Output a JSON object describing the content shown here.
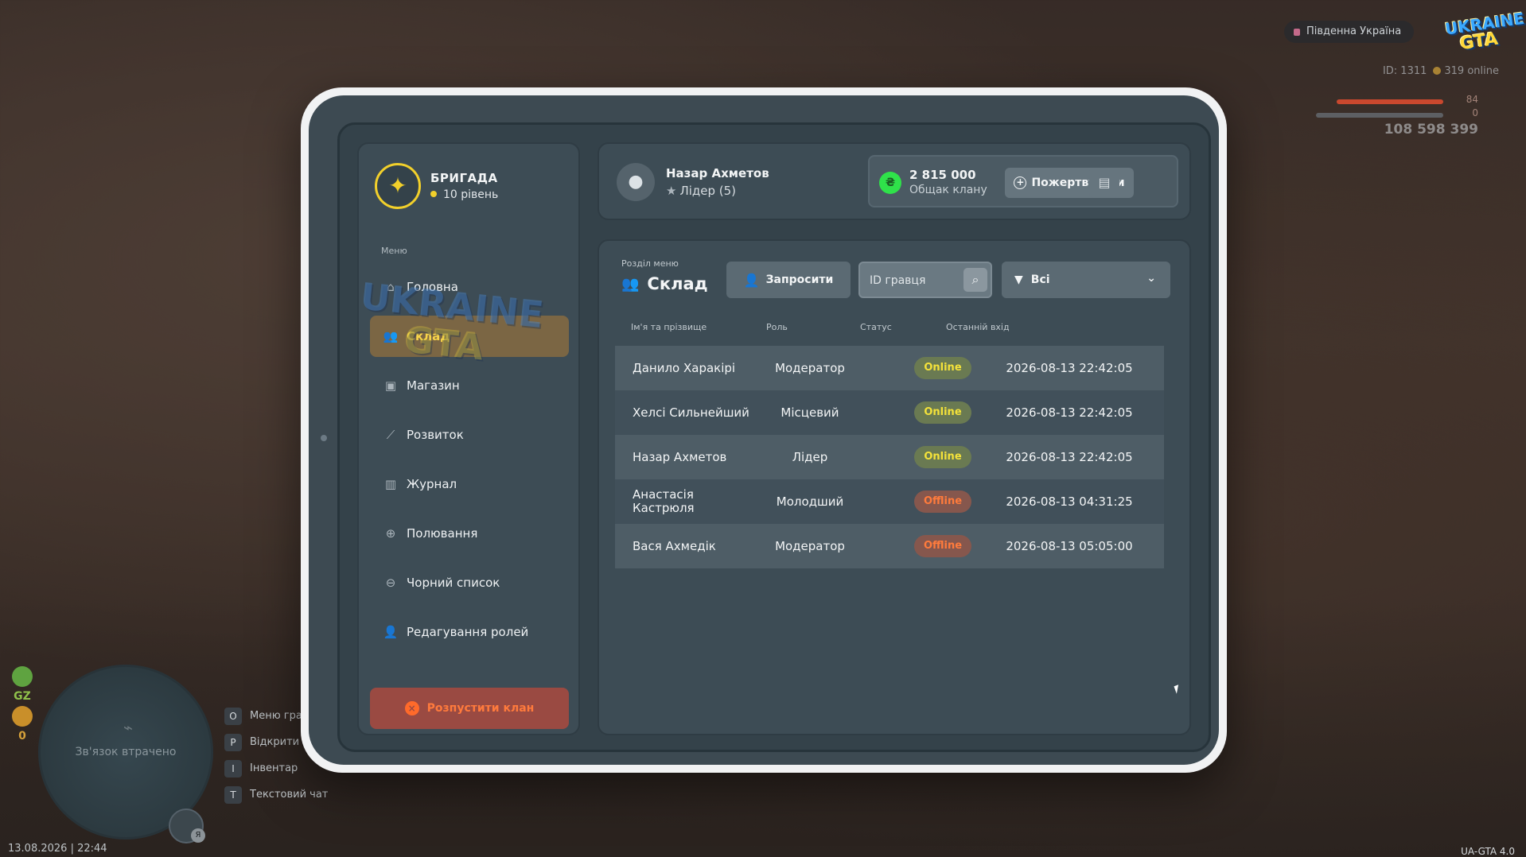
{
  "hud": {
    "region": "Південна Україна",
    "logo_top": "UKRAINE",
    "logo_bottom": "GTA",
    "player_id": "ID: 1311",
    "online": "319 online",
    "health": "84",
    "health_fraction": 0.84,
    "armor": "0",
    "armor_fraction": 0.0,
    "money": "108 598 399",
    "zone": "GZ",
    "wanted": "0",
    "connection": "Зв'язок втрачено",
    "mic_badge": "Я",
    "keys": [
      {
        "key": "O",
        "label": "Меню гравця"
      },
      {
        "key": "P",
        "label": "Відкрити телефон"
      },
      {
        "key": "I",
        "label": "Інвентар"
      },
      {
        "key": "T",
        "label": "Текстовий чат"
      }
    ],
    "datetime": "13.08.2026 | 22:44",
    "version": "UA-GTA 4.0"
  },
  "clan": {
    "name": "БРИГАДА",
    "level": "10 рівень"
  },
  "sidebar": {
    "caption": "Меню",
    "items": [
      {
        "label": "Головна",
        "icon": "home-icon"
      },
      {
        "label": "Склад",
        "icon": "people-icon"
      },
      {
        "label": "Магазин",
        "icon": "shop-icon"
      },
      {
        "label": "Розвиток",
        "icon": "chart-icon"
      },
      {
        "label": "Журнал",
        "icon": "book-icon"
      },
      {
        "label": "Полювання",
        "icon": "crosshair-icon"
      },
      {
        "label": "Чорний список",
        "icon": "block-icon"
      },
      {
        "label": "Редагування ролей",
        "icon": "user-edit-icon"
      }
    ],
    "disband_label": "Розпустити клан"
  },
  "user": {
    "name": "Назар Ахметов",
    "role": "Лідер (5)"
  },
  "bank": {
    "amount": "2 815 000",
    "caption": "Общак клану",
    "donate_label": "Пожертвувати",
    "coin": "₴"
  },
  "section": {
    "caption": "Розділ меню",
    "title": "Склад",
    "invite_label": "Запросити",
    "search_placeholder": "ID гравця",
    "filter_value": "Всі"
  },
  "table": {
    "headers": [
      "Ім'я та прізвище",
      "Роль",
      "Статус",
      "Останній вхід"
    ],
    "rows": [
      {
        "name": "Данило Харакірі",
        "role": "Модератор",
        "status": "Online",
        "last": "2026-08-13 22:42:05"
      },
      {
        "name": "Хелсі Сильнейший",
        "role": "Місцевий",
        "status": "Online",
        "last": "2026-08-13 22:42:05"
      },
      {
        "name": "Назар Ахметов",
        "role": "Лідер",
        "status": "Online",
        "last": "2026-08-13 22:42:05"
      },
      {
        "name": "Анастасія Кастрюля",
        "role": "Молодший",
        "status": "Offline",
        "last": "2026-08-13 04:31:25"
      },
      {
        "name": "Вася Ахмедік",
        "role": "Модератор",
        "status": "Offline",
        "last": "2026-08-13 05:05:00"
      }
    ]
  },
  "colors": {
    "accent": "#f7d44a",
    "online": "#f4e23a",
    "offline": "#ff7b3c",
    "panel": "#3d4c55"
  }
}
